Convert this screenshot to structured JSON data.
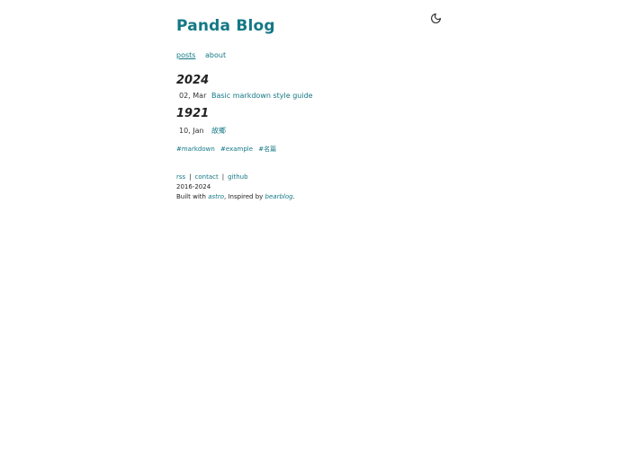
{
  "site": {
    "title": "Panda Blog",
    "accent_color": "#137885",
    "theme_icon": "moon-icon"
  },
  "nav": {
    "items": [
      {
        "label": "posts",
        "active": true
      },
      {
        "label": "about",
        "active": false
      }
    ]
  },
  "posts_by_year": [
    {
      "year": "2024",
      "posts": [
        {
          "date": "02, Mar",
          "title": "Basic markdown style guide"
        }
      ]
    },
    {
      "year": "1921",
      "posts": [
        {
          "date": "10, Jan",
          "title": "故鄉"
        }
      ]
    }
  ],
  "tags": [
    "#markdown",
    "#example",
    "#名篇"
  ],
  "footer": {
    "links": [
      "rss",
      "contact",
      "github"
    ],
    "separator": "|",
    "years": "2016-2024",
    "built_with_prefix": "Built with ",
    "built_with_link": "astro",
    "inspired_prefix": ", Inspired by ",
    "inspired_link": "bearblog",
    "suffix": "."
  }
}
